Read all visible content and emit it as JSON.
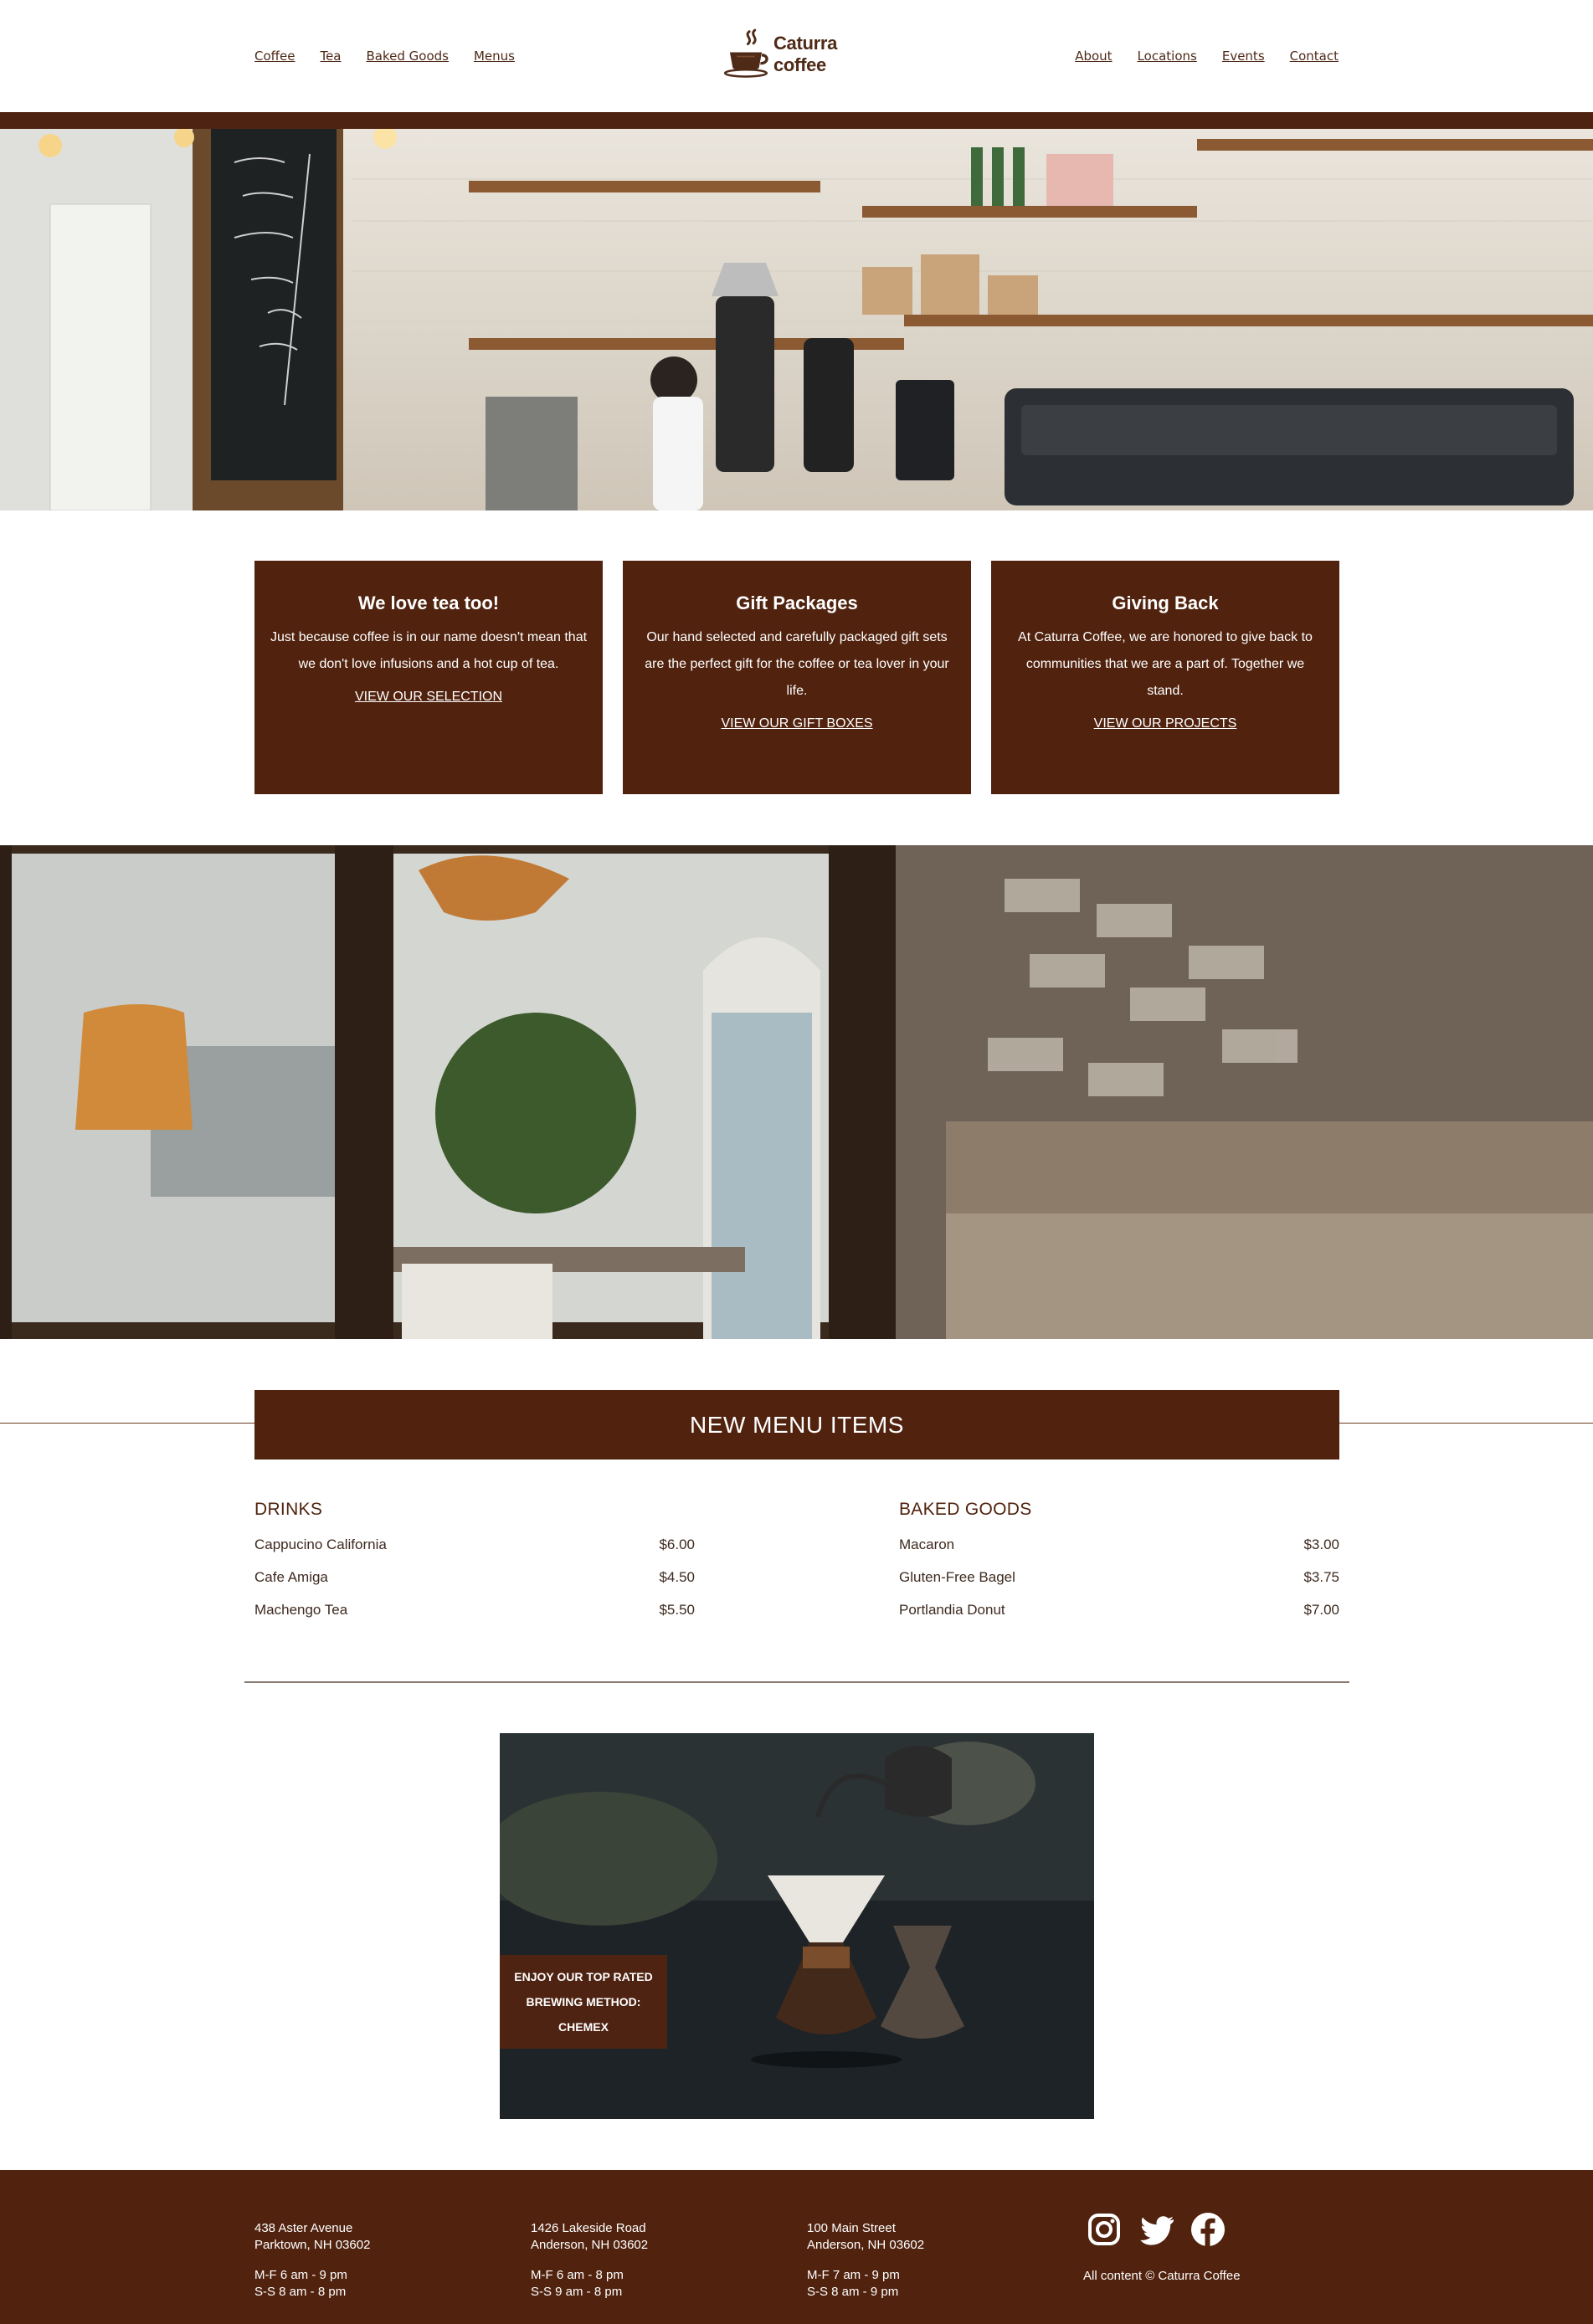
{
  "header": {
    "nav_left": [
      "Coffee",
      "Tea",
      "Baked Goods",
      "Menus"
    ],
    "nav_right": [
      "About",
      "Locations",
      "Events",
      "Contact"
    ],
    "logo_text": "Caturra coffee"
  },
  "cards": [
    {
      "title": "We love tea too!",
      "body": "Just because coffee is in our name doesn't mean that we don't love infusions and a hot cup of tea.",
      "link": "VIEW OUR SELECTION"
    },
    {
      "title": "Gift Packages",
      "body": "Our hand selected and carefully packaged gift sets are the perfect gift for the coffee or tea lover in your life.",
      "link": "VIEW OUR GIFT BOXES"
    },
    {
      "title": "Giving Back",
      "body": "At Caturra Coffee, we are honored to give back to communities that we are a part of. Together we stand.",
      "link": "VIEW OUR PROJECTS"
    }
  ],
  "menu": {
    "banner": "NEW MENU ITEMS",
    "drinks": {
      "heading": "DRINKS",
      "items": [
        {
          "name": "Cappucino California",
          "price": "$6.00"
        },
        {
          "name": "Cafe Amiga",
          "price": "$4.50"
        },
        {
          "name": "Machengo Tea",
          "price": "$5.50"
        }
      ]
    },
    "baked": {
      "heading": "BAKED GOODS",
      "items": [
        {
          "name": "Macaron",
          "price": "$3.00"
        },
        {
          "name": "Gluten-Free Bagel",
          "price": "$3.75"
        },
        {
          "name": "Portlandia Donut",
          "price": "$7.00"
        }
      ]
    }
  },
  "feature": {
    "label_line1": "ENJOY OUR TOP RATED",
    "label_line2": "BREWING METHOD:",
    "label_line3": "CHEMEX"
  },
  "footer": {
    "locations": [
      {
        "street": "438 Aster Avenue",
        "city": "Parktown, NH 03602",
        "hours1": "M-F 6 am - 9 pm",
        "hours2": "S-S 8 am - 8 pm"
      },
      {
        "street": "1426 Lakeside Road",
        "city": "Anderson, NH 03602",
        "hours1": "M-F 6 am - 8 pm",
        "hours2": "S-S 9 am - 8 pm"
      },
      {
        "street": "100 Main Street",
        "city": "Anderson, NH 03602",
        "hours1": "M-F 7 am - 9 pm",
        "hours2": "S-S 8 am - 9 pm"
      }
    ],
    "social_icons": [
      "instagram-icon",
      "twitter-icon",
      "facebook-icon"
    ],
    "copyright": "All content © Caturra Coffee"
  },
  "colors": {
    "brand_brown": "#51230f",
    "link_brown": "#4e2a17",
    "background": "#ffffff"
  }
}
